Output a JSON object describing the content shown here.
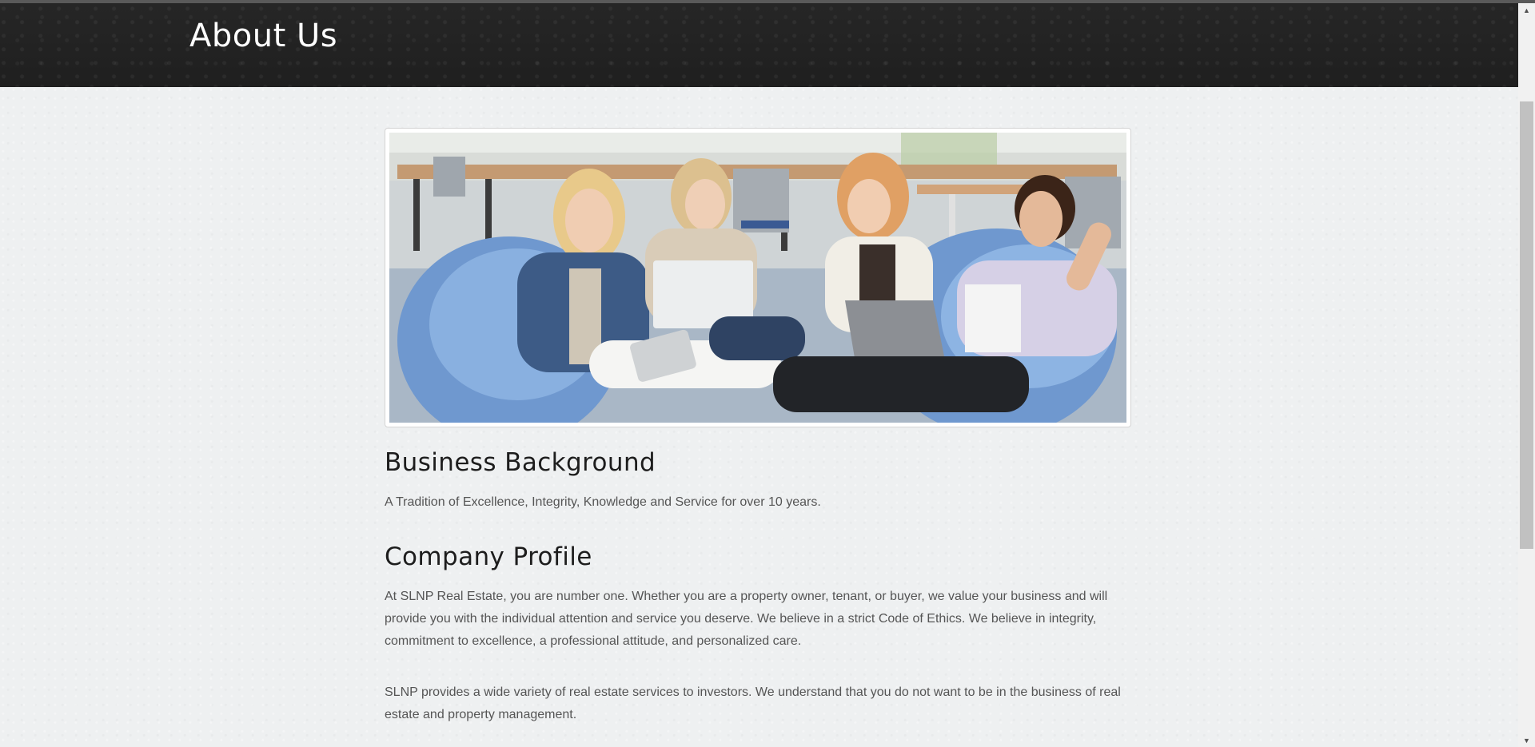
{
  "header": {
    "title": "About Us"
  },
  "hero": {
    "image": "team-photo-group-with-laptops"
  },
  "sections": [
    {
      "heading": "Business Background",
      "paragraphs": [
        "A Tradition of Excellence, Integrity, Knowledge and Service for over 10 years."
      ]
    },
    {
      "heading": "Company Profile",
      "paragraphs": [
        "At SLNP Real Estate, you are number one. Whether you are a property owner, tenant, or buyer, we value your business and will provide you with the individual attention and service you deserve. We believe in a strict Code of Ethics. We believe in integrity, commitment to excellence, a professional attitude, and personalized care.",
        "SLNP provides a wide variety of real estate services to investors. We understand that you do not want to be in the business of real estate and property management."
      ]
    }
  ],
  "scrollbar": {
    "up_icon": "scroll-up-arrow-icon",
    "down_icon": "scroll-down-arrow-icon"
  },
  "colors": {
    "header_bg": "#222222",
    "page_bg": "#eef0f1",
    "heading_text": "#1d1d1d",
    "body_text": "#555555"
  }
}
